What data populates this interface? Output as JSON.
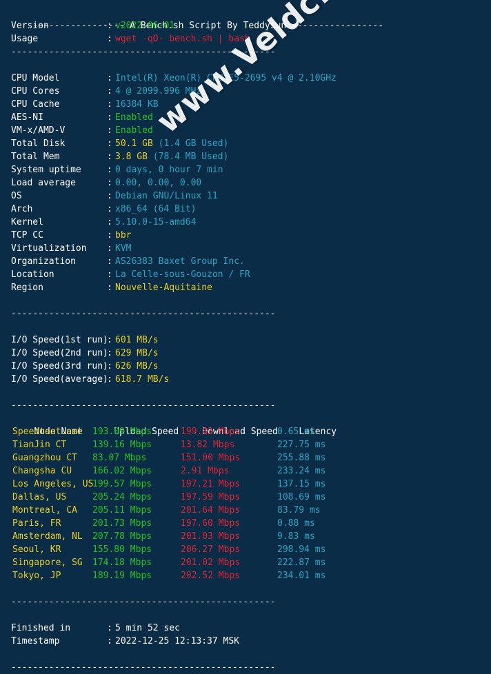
{
  "terminal": {
    "background_color": "#0a2c46",
    "colors": {
      "white": "#ffffff",
      "green": "#22c322",
      "red": "#e02434",
      "cyan": "#2ba6c4",
      "yellow": "#e9d024"
    }
  },
  "watermark": {
    "text": "www.Veldc.com"
  },
  "header": {
    "separator_left": "-----------------",
    "title": "A Bench.sh Script By Teddysun",
    "separator_right": "-----------------"
  },
  "separators": {
    "dashed": "-------------------------------------------------"
  },
  "intro": {
    "rows": [
      {
        "label": "Version",
        "colon": ":",
        "value": "v2022-06-01",
        "color": "green"
      },
      {
        "label": "Usage",
        "colon": ":",
        "value": "wget -qO- bench.sh | bash",
        "color": "red"
      }
    ]
  },
  "sysinfo": {
    "rows": [
      {
        "label": "CPU Model",
        "colon": ":",
        "value": "Intel(R) Xeon(R) CPU E5-2695 v4 @ 2.10GHz",
        "color": "cyan"
      },
      {
        "label": "CPU Cores",
        "colon": ":",
        "value": "4 @ 2099.996 MHz",
        "color": "cyan"
      },
      {
        "label": "CPU Cache",
        "colon": ":",
        "value": "16384 KB",
        "color": "cyan"
      },
      {
        "label": "AES-NI",
        "colon": ":",
        "value": "Enabled",
        "color": "green"
      },
      {
        "label": "VM-x/AMD-V",
        "colon": ":",
        "value": "Enabled",
        "color": "green"
      },
      {
        "label": "Total Disk",
        "colon": ":",
        "value": "50.1 GB",
        "color": "yellow",
        "suffix": " (1.4 GB Used)",
        "suffix_color": "cyan"
      },
      {
        "label": "Total Mem",
        "colon": ":",
        "value": "3.8 GB",
        "color": "yellow",
        "suffix": " (78.4 MB Used)",
        "suffix_color": "cyan"
      },
      {
        "label": "System uptime",
        "colon": ":",
        "value": "0 days, 0 hour 7 min",
        "color": "cyan"
      },
      {
        "label": "Load average",
        "colon": ":",
        "value": "0.00, 0.00, 0.00",
        "color": "cyan"
      },
      {
        "label": "OS",
        "colon": ":",
        "value": "Debian GNU/Linux 11",
        "color": "cyan"
      },
      {
        "label": "Arch",
        "colon": ":",
        "value": "x86_64 (64 Bit)",
        "color": "cyan"
      },
      {
        "label": "Kernel",
        "colon": ":",
        "value": "5.10.0-15-amd64",
        "color": "cyan"
      },
      {
        "label": "TCP CC",
        "colon": ":",
        "value": "bbr",
        "color": "yellow"
      },
      {
        "label": "Virtualization",
        "colon": ":",
        "value": "KVM",
        "color": "cyan"
      },
      {
        "label": "Organization",
        "colon": ":",
        "value": "AS26383 Baxet Group Inc.",
        "color": "cyan"
      },
      {
        "label": "Location",
        "colon": ":",
        "value": "La Celle-sous-Gouzon / FR",
        "color": "cyan"
      },
      {
        "label": "Region",
        "colon": ":",
        "value": "Nouvelle-Aquitaine",
        "color": "yellow"
      }
    ]
  },
  "io_speed": {
    "rows": [
      {
        "label": "I/O Speed(1st run)",
        "colon": ":",
        "value": "601 MB/s",
        "color": "yellow"
      },
      {
        "label": "I/O Speed(2nd run)",
        "colon": ":",
        "value": "629 MB/s",
        "color": "yellow"
      },
      {
        "label": "I/O Speed(3rd run)",
        "colon": ":",
        "value": "626 MB/s",
        "color": "yellow"
      },
      {
        "label": "I/O Speed(average)",
        "colon": ":",
        "value": "618.7 MB/s",
        "color": "yellow"
      }
    ]
  },
  "speedtest": {
    "columns": [
      "Node Name",
      "Upload Speed",
      "Download Speed",
      "Latency"
    ],
    "rows": [
      {
        "node": "Speedtest.net",
        "upload": "193.09 Mbps",
        "download": "199.83 Mbps",
        "latency": "0.65 ms"
      },
      {
        "node": "TianJin CT",
        "upload": "139.16 Mbps",
        "download": "13.82 Mbps",
        "latency": "227.75 ms"
      },
      {
        "node": "Guangzhou CT",
        "upload": "83.07 Mbps",
        "download": "151.00 Mbps",
        "latency": "255.88 ms"
      },
      {
        "node": "Changsha CU",
        "upload": "166.02 Mbps",
        "download": "2.91 Mbps",
        "latency": "233.24 ms"
      },
      {
        "node": "Los Angeles, US",
        "upload": "199.57 Mbps",
        "download": "197.21 Mbps",
        "latency": "137.15 ms"
      },
      {
        "node": "Dallas, US",
        "upload": "205.24 Mbps",
        "download": "197.59 Mbps",
        "latency": "108.69 ms"
      },
      {
        "node": "Montreal, CA",
        "upload": "205.11 Mbps",
        "download": "201.64 Mbps",
        "latency": "83.79 ms"
      },
      {
        "node": "Paris, FR",
        "upload": "201.73 Mbps",
        "download": "197.60 Mbps",
        "latency": "0.88 ms"
      },
      {
        "node": "Amsterdam, NL",
        "upload": "207.78 Mbps",
        "download": "201.03 Mbps",
        "latency": "9.83 ms"
      },
      {
        "node": "Seoul, KR",
        "upload": "155.80 Mbps",
        "download": "206.27 Mbps",
        "latency": "298.94 ms"
      },
      {
        "node": "Singapore, SG",
        "upload": "174.18 Mbps",
        "download": "201.02 Mbps",
        "latency": "222.87 ms"
      },
      {
        "node": "Tokyo, JP",
        "upload": "189.19 Mbps",
        "download": "202.52 Mbps",
        "latency": "234.01 ms"
      }
    ]
  },
  "footer": {
    "rows": [
      {
        "label": "Finished in",
        "colon": ":",
        "value": "5 min 52 sec",
        "color": "white"
      },
      {
        "label": "Timestamp",
        "colon": ":",
        "value": "2022-12-25 12:13:37 MSK",
        "color": "white"
      }
    ]
  }
}
